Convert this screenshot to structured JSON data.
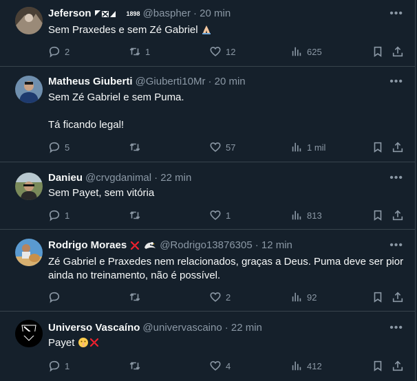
{
  "tweets": [
    {
      "name": "Jeferson",
      "badge": "1898",
      "handle": "@baspher",
      "time": "· 20 min",
      "text": "Sem Praxedes e sem Zé Gabriel",
      "replies": "2",
      "retweets": "1",
      "likes": "12",
      "views": "625"
    },
    {
      "name": "Matheus Giuberti",
      "handle": "@Giuberti10Mr",
      "time": "· 20 min",
      "text": "Sem Zé Gabriel e sem Puma.\n\nTá ficando legal!",
      "replies": "5",
      "retweets": "",
      "likes": "57",
      "views": "1 mil"
    },
    {
      "name": "Danieu",
      "handle": "@crvgdanimal",
      "time": "· 22 min",
      "text": "Sem Payet, sem vitória",
      "replies": "1",
      "retweets": "",
      "likes": "1",
      "views": "813"
    },
    {
      "name": "Rodrigo Moraes",
      "handle": "@Rodrigo13876305",
      "time": "· 12 min",
      "text": "Zé Gabriel e Praxedes nem relacionados, graças a Deus. Puma deve ser pior\nainda no treinamento, não é possível.",
      "replies": "",
      "retweets": "",
      "likes": "2",
      "views": "92"
    },
    {
      "name": "Universo Vascaíno",
      "handle": "@univervascaino",
      "time": "· 22 min",
      "text": "Payet",
      "replies": "1",
      "retweets": "",
      "likes": "4",
      "views": "412"
    }
  ],
  "icons": {
    "more": "more-icon",
    "reply": "reply-icon",
    "retweet": "retweet-icon",
    "like": "heart-icon",
    "views": "views-icon",
    "bookmark": "bookmark-icon",
    "share": "share-icon"
  },
  "colors": {
    "background": "#15202b",
    "divider": "#38444d",
    "text": "#f7f9f9",
    "muted": "#8b98a5"
  }
}
